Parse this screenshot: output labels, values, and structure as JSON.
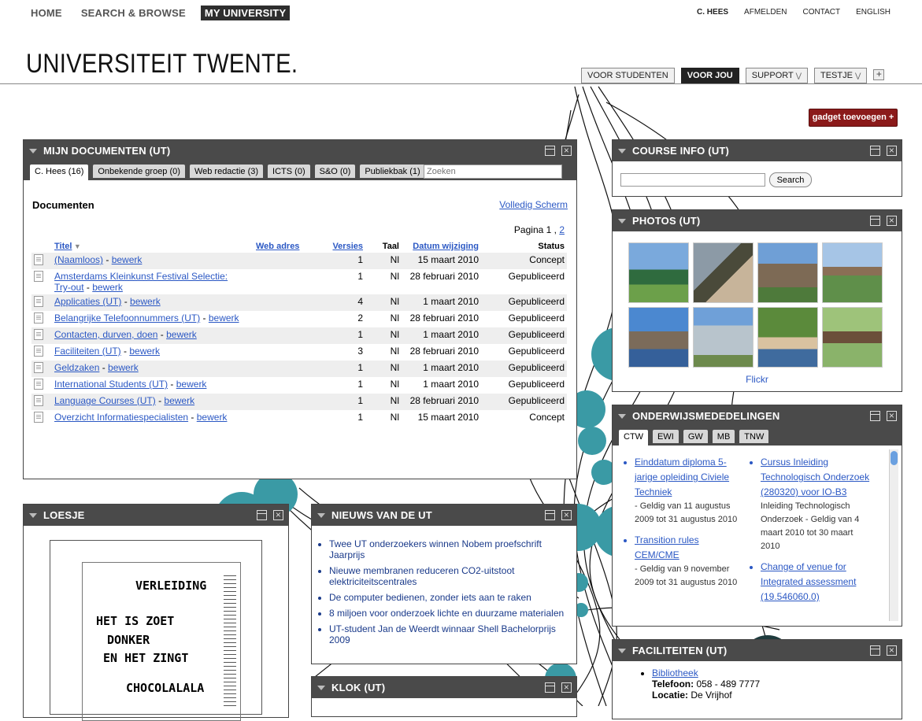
{
  "topnav": {
    "home": "HOME",
    "search": "SEARCH & BROWSE",
    "my": "MY UNIVERSITY"
  },
  "usernav": {
    "user": "C. HEES",
    "logout": "AFMELDEN",
    "contact": "CONTACT",
    "lang": "ENGLISH"
  },
  "logo": "UNIVERSITEIT TWENTE.",
  "tabs": {
    "students": "VOOR STUDENTEN",
    "you": "VOOR JOU",
    "support": "SUPPORT",
    "testje": "TESTJE",
    "add": "+"
  },
  "gadget_button": "gadget toevoegen +",
  "docs": {
    "title": "MIJN DOCUMENTEN (UT)",
    "subtabs": [
      "C. Hees (16)",
      "Onbekende groep (0)",
      "Web redactie (3)",
      "ICTS (0)",
      "S&O (0)",
      "Publiekbak (1)"
    ],
    "search_placeholder": "Zoeken",
    "heading": "Documenten",
    "fullscreen": "Volledig Scherm",
    "paging_label": "Pagina 1 ,",
    "paging_next": "2",
    "columns": {
      "title": "Titel",
      "web": "Web adres",
      "versions": "Versies",
      "lang": "Taal",
      "date": "Datum wijziging",
      "status": "Status"
    },
    "edit": "bewerk",
    "rows": [
      {
        "title": "(Naamloos)",
        "versions": "1",
        "lang": "Nl",
        "date": "15 maart 2010",
        "status": "Concept"
      },
      {
        "title": "Amsterdams Kleinkunst Festival Selectie:",
        "title2": "Try-out",
        "versions": "1",
        "lang": "Nl",
        "date": "28 februari 2010",
        "status": "Gepubliceerd"
      },
      {
        "title": "Applicaties (UT)",
        "versions": "4",
        "lang": "Nl",
        "date": "1 maart 2010",
        "status": "Gepubliceerd"
      },
      {
        "title": "Belangrijke Telefoonnummers (UT)",
        "versions": "2",
        "lang": "Nl",
        "date": "28 februari 2010",
        "status": "Gepubliceerd"
      },
      {
        "title": "Contacten, durven, doen",
        "versions": "1",
        "lang": "Nl",
        "date": "1 maart 2010",
        "status": "Gepubliceerd"
      },
      {
        "title": "Faciliteiten (UT)",
        "versions": "3",
        "lang": "Nl",
        "date": "28 februari 2010",
        "status": "Gepubliceerd"
      },
      {
        "title": "Geldzaken",
        "versions": "1",
        "lang": "Nl",
        "date": "1 maart 2010",
        "status": "Gepubliceerd"
      },
      {
        "title": "International Students (UT)",
        "versions": "1",
        "lang": "Nl",
        "date": "1 maart 2010",
        "status": "Gepubliceerd"
      },
      {
        "title": "Language Courses (UT)",
        "versions": "1",
        "lang": "Nl",
        "date": "28 februari 2010",
        "status": "Gepubliceerd"
      },
      {
        "title": "Overzicht Informatiespecialisten",
        "versions": "1",
        "lang": "Nl",
        "date": "15 maart 2010",
        "status": "Concept"
      }
    ]
  },
  "course": {
    "title": "COURSE INFO (UT)",
    "button": "Search"
  },
  "photos": {
    "title": "PHOTOS (UT)",
    "link": "Flickr"
  },
  "onderwijs": {
    "title": "ONDERWIJSMEDEDELINGEN",
    "tabs": [
      "CTW",
      "EWI",
      "GW",
      "MB",
      "TNW"
    ],
    "left": [
      {
        "link": "Einddatum diploma 5-jarige opleiding Civiele Techniek",
        "meta": "- Geldig van 11 augustus 2009 tot 31 augustus 2010"
      },
      {
        "link": "Transition rules CEM/CME",
        "meta": "- Geldig van 9 november 2009 tot 31 augustus 2010"
      }
    ],
    "right": [
      {
        "link": "Cursus Inleiding Technologisch Onderzoek (280320) voor IO-B3",
        "meta": "Inleiding Technologisch Onderzoek - Geldig van 4 maart 2010 tot 30 maart 2010"
      },
      {
        "link": "Change of venue for Integrated assessment (19.546060.0)",
        "meta": ""
      }
    ]
  },
  "loesje": {
    "title": "LOESJE",
    "lines": [
      "VERLEIDING",
      "HET IS ZOET",
      "DONKER",
      "EN HET ZINGT",
      "CHOCOLALALA"
    ]
  },
  "nieuws": {
    "title": "NIEUWS VAN DE UT",
    "items": [
      "Twee UT onderzoekers winnen Nobem proefschrift Jaarprijs",
      "Nieuwe membranen reduceren CO2-uitstoot elektriciteitscentrales",
      "De computer bedienen, zonder iets aan te raken",
      "8 miljoen voor onderzoek lichte en duurzame materialen",
      "UT-student Jan de Weerdt winnaar Shell Bachelorprijs 2009"
    ]
  },
  "klok": {
    "title": "KLOK (UT)"
  },
  "faciliteiten": {
    "title": "FACILITEITEN (UT)",
    "link": "Bibliotheek",
    "phone_label": "Telefoon:",
    "phone": "058 - 489 7777",
    "loc_label": "Locatie:",
    "loc": "De Vrijhof"
  },
  "colors": {
    "header": "#4a4a4a",
    "accent": "#8b1a1a",
    "teal": "#3a9aa5",
    "link": "#2b58c4"
  }
}
